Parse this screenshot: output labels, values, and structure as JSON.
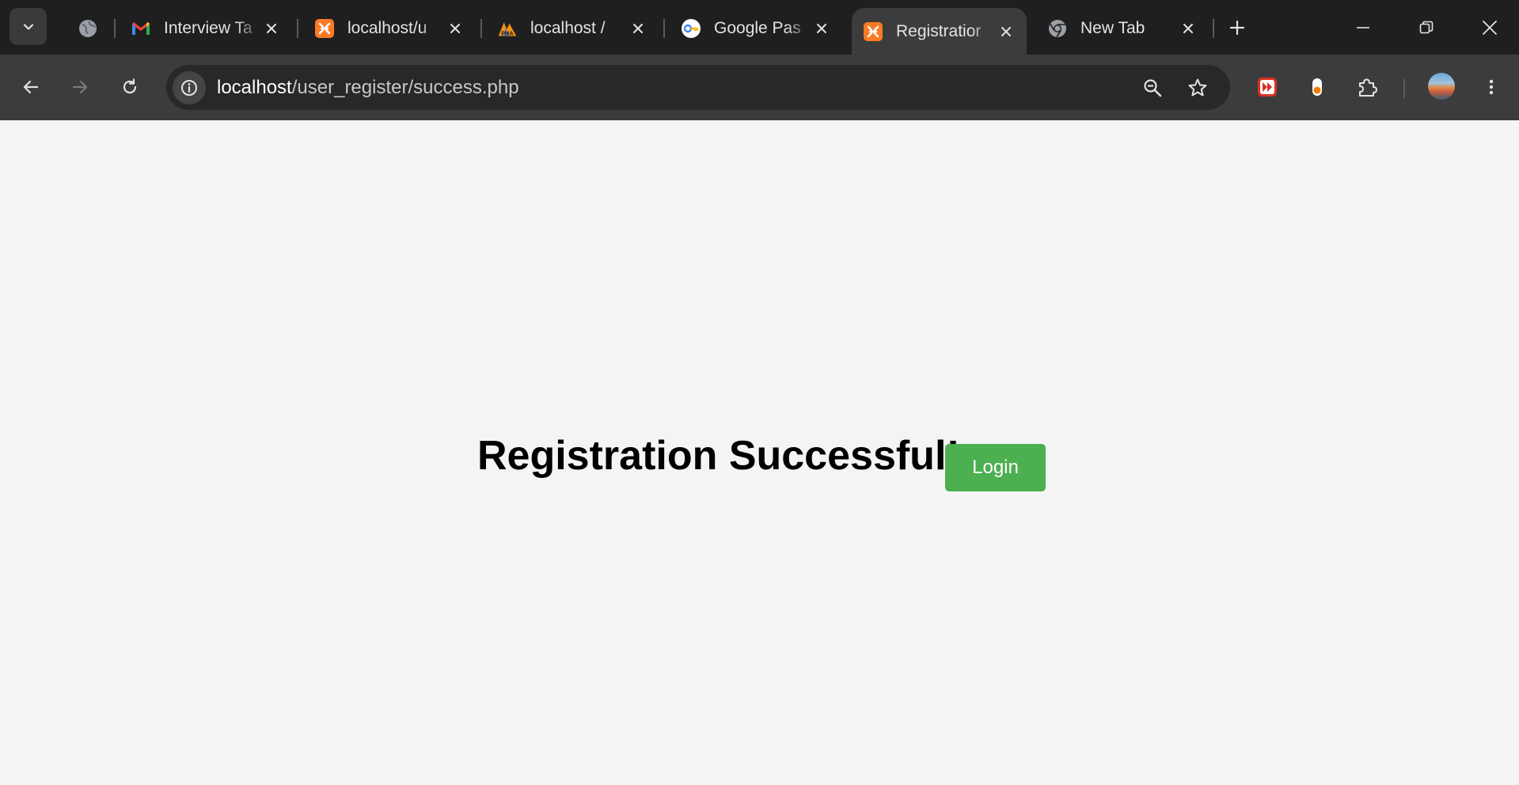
{
  "tabs": [
    {
      "title": "Interview Ta",
      "favicon": "gmail-icon",
      "active": false
    },
    {
      "title": "localhost/u",
      "favicon": "xampp-icon",
      "active": false
    },
    {
      "title": "localhost / ",
      "favicon": "phpmyadmin-icon",
      "active": false
    },
    {
      "title": "Google Pas",
      "favicon": "google-passwords-icon",
      "active": false
    },
    {
      "title": "Registratior",
      "favicon": "xampp-icon",
      "active": true
    },
    {
      "title": "New Tab",
      "favicon": "chrome-icon",
      "active": false
    }
  ],
  "address_bar": {
    "host": "localhost",
    "path": "/user_register/success.php"
  },
  "page": {
    "heading": "Registration Successful!",
    "login_label": "Login"
  },
  "colors": {
    "login_button": "#4caf50",
    "page_background": "#f4f4f4",
    "tabstrip": "#1f1f1f",
    "toolbar": "#3c3c3c"
  }
}
